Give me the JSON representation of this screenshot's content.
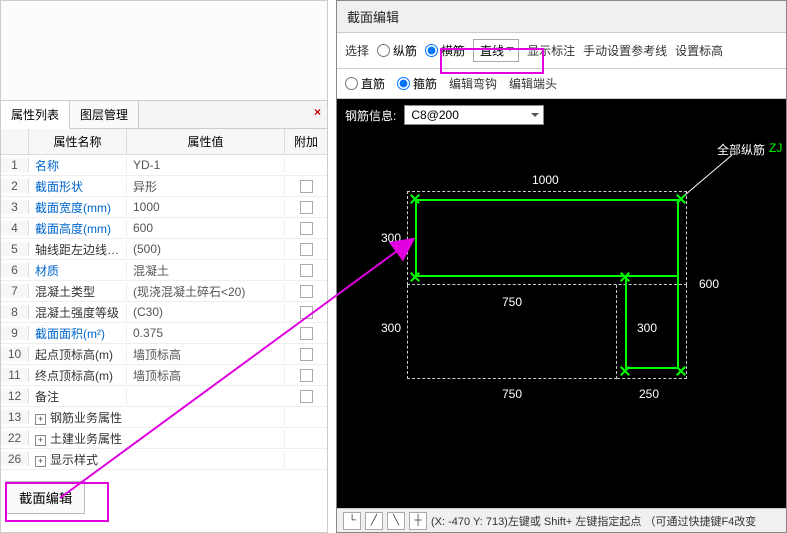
{
  "leftPanel": {
    "tabs": {
      "props": "属性列表",
      "layers": "图层管理"
    },
    "headers": {
      "name": "属性名称",
      "value": "属性值",
      "extra": "附加"
    },
    "rows": [
      {
        "num": "1",
        "name": "名称",
        "value": "YD-1",
        "blue": true,
        "check": false
      },
      {
        "num": "2",
        "name": "截面形状",
        "value": "异形",
        "blue": true,
        "check": true
      },
      {
        "num": "3",
        "name": "截面宽度(mm)",
        "value": "1000",
        "blue": true,
        "check": true
      },
      {
        "num": "4",
        "name": "截面高度(mm)",
        "value": "600",
        "blue": true,
        "check": true
      },
      {
        "num": "5",
        "name": "轴线距左边线…",
        "value": "(500)",
        "blue": false,
        "check": true
      },
      {
        "num": "6",
        "name": "材质",
        "value": "混凝土",
        "blue": true,
        "check": true
      },
      {
        "num": "7",
        "name": "混凝土类型",
        "value": "(现浇混凝土碎石<20)",
        "blue": false,
        "check": true
      },
      {
        "num": "8",
        "name": "混凝土强度等级",
        "value": "(C30)",
        "blue": false,
        "check": true
      },
      {
        "num": "9",
        "name": "截面面积(m²)",
        "value": "0.375",
        "blue": true,
        "check": true
      },
      {
        "num": "10",
        "name": "起点顶标高(m)",
        "value": "墙顶标高",
        "blue": false,
        "check": true
      },
      {
        "num": "11",
        "name": "终点顶标高(m)",
        "value": "墙顶标高",
        "blue": false,
        "check": true
      },
      {
        "num": "12",
        "name": "备注",
        "value": "",
        "blue": false,
        "check": true
      }
    ],
    "expandRows": [
      {
        "num": "13",
        "name": "钢筋业务属性"
      },
      {
        "num": "22",
        "name": "土建业务属性"
      },
      {
        "num": "26",
        "name": "显示样式"
      }
    ],
    "sectionEditBtn": "截面编辑"
  },
  "rightPanel": {
    "title": "截面编辑",
    "toolbar1": {
      "select": "选择",
      "vertical": "纵筋",
      "horizontal": "横筋",
      "line": "直线",
      "showMarker": "显示标注",
      "manualRef": "手动设置参考线",
      "setElev": "设置标高"
    },
    "toolbar2": {
      "straight": "直筋",
      "stirrup": "箍筋",
      "editHook": "编辑弯钩",
      "editEnd": "编辑端头"
    },
    "infoLabel": "钢筋信息:",
    "infoValue": "C8@200",
    "dims": {
      "w1000": "1000",
      "h300l": "300",
      "h300l2": "300",
      "w750t": "750",
      "w750b": "750",
      "h300r": "300",
      "h600": "600",
      "w250": "250"
    },
    "labelAll": "全部纵筋",
    "labelZJ": "ZJ",
    "status": "(X: -470 Y: 713)左键或 Shift+ 左键指定起点 （可通过快捷键F4改变"
  }
}
